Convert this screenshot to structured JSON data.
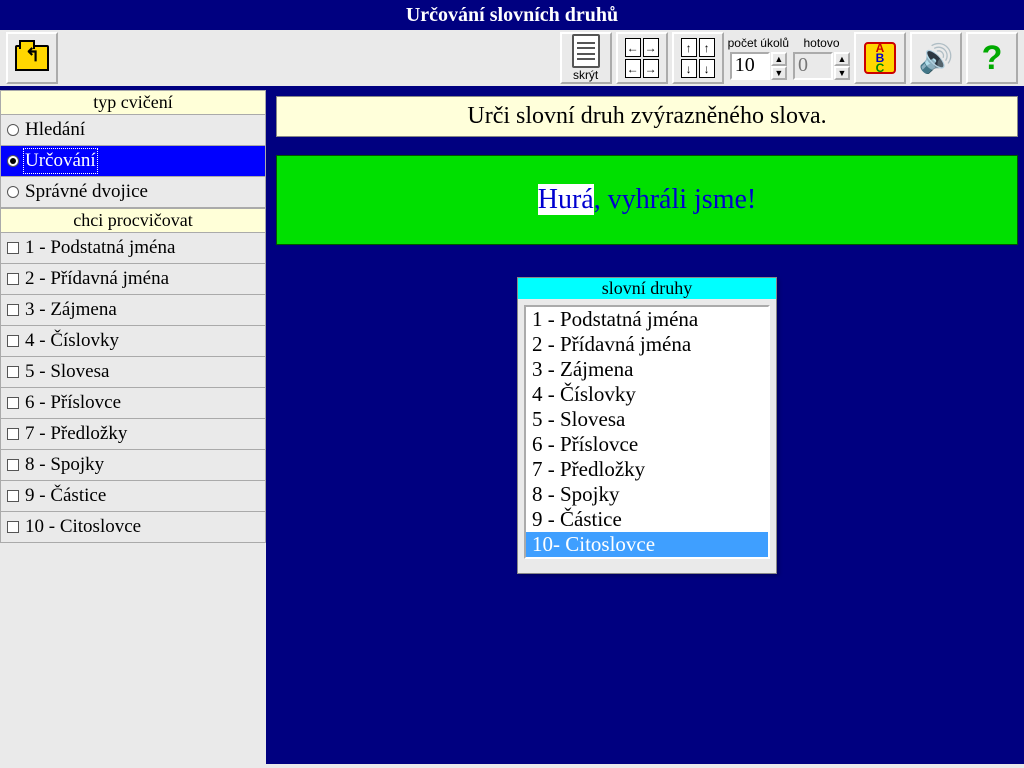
{
  "title": "Určování slovních druhů",
  "toolbar": {
    "hide_label": "skrýt",
    "count_label": "počet úkolů",
    "count_value": "10",
    "done_label": "hotovo",
    "done_value": "0"
  },
  "sidebar": {
    "type_header": "typ cvičení",
    "types": [
      {
        "label": "Hledání",
        "selected": false
      },
      {
        "label": "Určování",
        "selected": true
      },
      {
        "label": "Správné dvojice",
        "selected": false
      }
    ],
    "practice_header": "chci procvičovat",
    "practice": [
      "1 - Podstatná jména",
      "2 - Přídavná jména",
      "3 - Zájmena",
      "4 - Číslovky",
      "5 - Slovesa",
      "6 - Příslovce",
      "7 - Předložky",
      "8 - Spojky",
      "9 - Částice",
      "10 - Citoslovce"
    ]
  },
  "main": {
    "instruction": "Urči slovní druh zvýrazněného slova.",
    "sentence_hl": "Hurá",
    "sentence_rest": ", vyhráli jsme!",
    "answer_header": "slovní druhy",
    "answers": [
      "1 - Podstatná jména",
      "2 - Přídavná jména",
      "3 - Zájmena",
      "4 - Číslovky",
      "5 - Slovesa",
      "6 - Příslovce",
      "7 - Předložky",
      "8 - Spojky",
      "9 - Částice",
      "10- Citoslovce"
    ],
    "answer_selected": 9
  }
}
